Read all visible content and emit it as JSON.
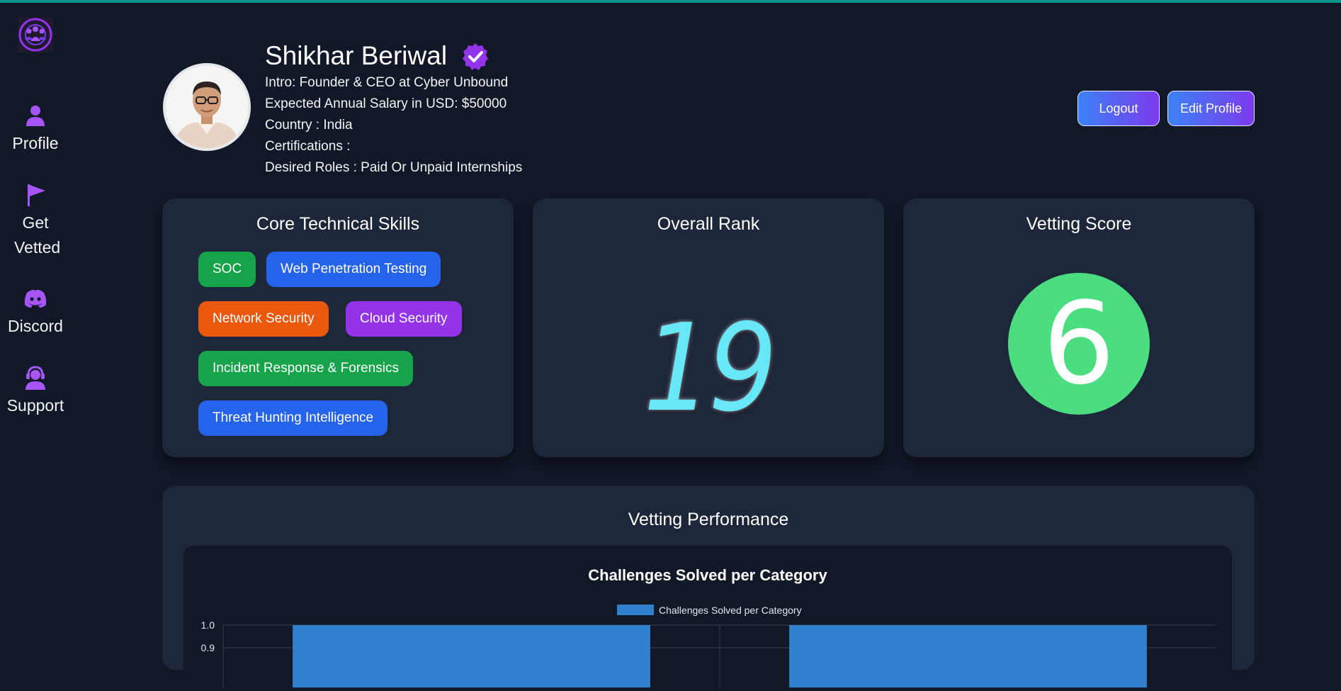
{
  "sidebar": {
    "logo": "logo-icon",
    "items": [
      {
        "label": "Profile",
        "icon": "user-icon"
      },
      {
        "label": "Get Vetted",
        "icon": "flag-icon"
      },
      {
        "label": "Discord",
        "icon": "discord-icon"
      },
      {
        "label": "Support",
        "icon": "headset-icon"
      }
    ]
  },
  "profile": {
    "name": "Shikhar Beriwal",
    "intro": "Intro: Founder & CEO at Cyber Unbound",
    "salary": "Expected Annual Salary in USD: $50000",
    "country": "Country : India",
    "certifications": "Certifications :",
    "desired_roles": "Desired Roles : Paid Or Unpaid Internships"
  },
  "header_buttons": {
    "logout": "Logout",
    "edit_profile": "Edit Profile"
  },
  "skills_card": {
    "title": "Core Technical Skills",
    "skills": [
      {
        "label": "SOC",
        "color": "#16a34a"
      },
      {
        "label": "Web Penetration Testing",
        "color": "#2563eb"
      },
      {
        "label": "Network Security",
        "color": "#ea580c"
      },
      {
        "label": "Cloud Security",
        "color": "#9333ea"
      },
      {
        "label": "Incident Response & Forensics",
        "color": "#16a34a"
      },
      {
        "label": "Threat Hunting Intelligence",
        "color": "#2563eb"
      }
    ]
  },
  "rank_card": {
    "title": "Overall Rank",
    "value": "19"
  },
  "score_card": {
    "title": "Vetting Score",
    "value": "6"
  },
  "performance": {
    "title": "Vetting Performance"
  },
  "colors": {
    "accent_purple": "#9333ea",
    "teal_line": "#0d9488",
    "bar_blue": "#3182ce"
  },
  "chart_data": {
    "type": "bar",
    "title": "Challenges Solved per Category",
    "legend": "top",
    "series": [
      {
        "name": "Challenges Solved per Category",
        "values": [
          1,
          1
        ]
      }
    ],
    "y_tick_labels": [
      "1.0",
      "0.9"
    ],
    "ylim": [
      0,
      1.0
    ],
    "grid": true
  }
}
